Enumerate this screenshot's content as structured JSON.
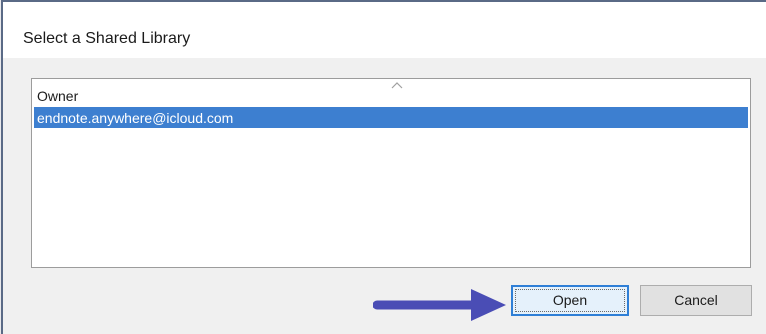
{
  "dialog": {
    "title": "Select a Shared Library"
  },
  "list": {
    "column_header": "Owner",
    "sort_icon": "sort-up-chevron",
    "rows": [
      {
        "owner": "endnote.anywhere@icloud.com",
        "selected": true
      }
    ]
  },
  "buttons": {
    "open_label": "Open",
    "cancel_label": "Cancel"
  },
  "annotation": {
    "icon": "arrow-right",
    "color": "#4a4db5"
  },
  "colors": {
    "selection": "#3d7fd0",
    "default_button_border": "#2f7fd6"
  }
}
